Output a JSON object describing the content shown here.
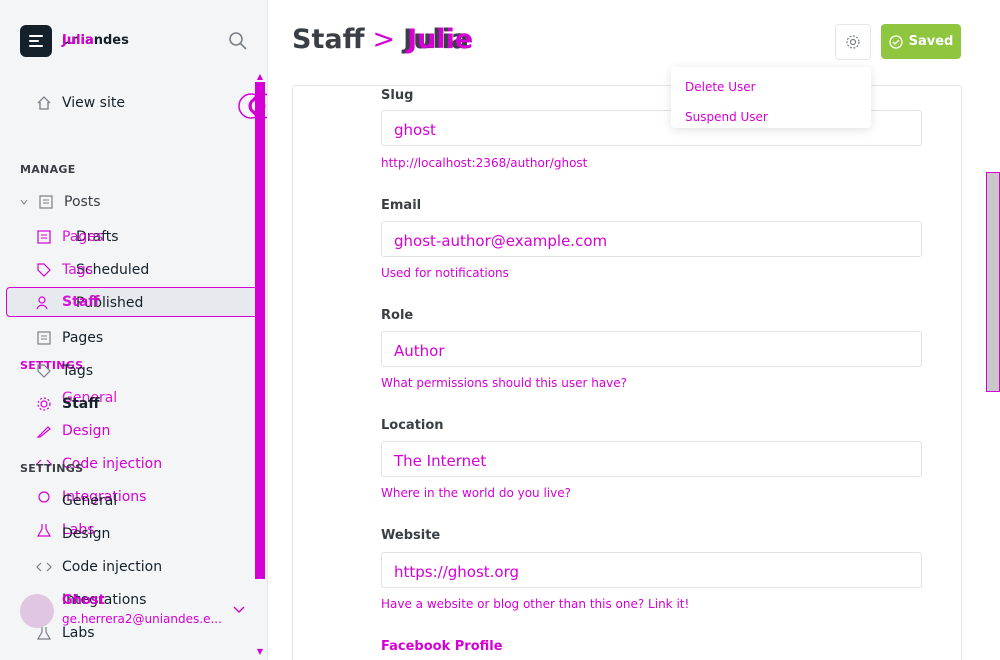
{
  "app": {
    "brand_name": "uniandes",
    "brand_name_overlay": "Julia"
  },
  "sidebar": {
    "view_site": "View site",
    "manage_label": "MANAGE",
    "settings_label": "SETTINGS",
    "settings_label_overlay": "SETTINGS",
    "posts": "Posts",
    "drafts": "Drafts",
    "scheduled": "Scheduled",
    "published": "Published",
    "pages": "Pages",
    "tags": "Tags",
    "staff": "Staff",
    "general": "General",
    "design": "Design",
    "code_injection": "Code injection",
    "integrations": "Integrations",
    "labs": "Labs",
    "overlay_pages": "Pages",
    "overlay_tags": "Tags",
    "overlay_staff": "Staff",
    "overlay_general": "General",
    "overlay_design": "Design",
    "overlay_code_injection": "Code injection",
    "overlay_integrations": "Integrations",
    "overlay_labs": "Labs",
    "user_name": "Ghost",
    "user_email": "ge.herrera2@uniandes.e..."
  },
  "header": {
    "crumb": "Staff",
    "separator": ">",
    "user_name": "Julia",
    "user_name_overlay": "Julie",
    "saved_label": "Saved"
  },
  "menu": {
    "delete_user": "Delete User",
    "suspend_user": "Suspend User"
  },
  "form": {
    "slug_label": "Slug",
    "slug_value": "ghost",
    "slug_hint": "http://localhost:2368/author/ghost",
    "email_label": "Email",
    "email_value": "ghost-author@example.com",
    "email_hint": "Used for notifications",
    "role_label": "Role",
    "role_value": "Author",
    "role_hint": "What permissions should this user have?",
    "location_label": "Location",
    "location_value": "The Internet",
    "location_hint": "Where in the world do you live?",
    "website_label": "Website",
    "website_value": "https://ghost.org",
    "website_hint": "Have a website or blog other than this one? Link it!",
    "facebook_label": "Facebook Profile"
  },
  "colors": {
    "accent": "#8ec63f",
    "overlay": "#d400d4",
    "sidebar_bg": "#f4f5f7",
    "text": "#15212a"
  }
}
